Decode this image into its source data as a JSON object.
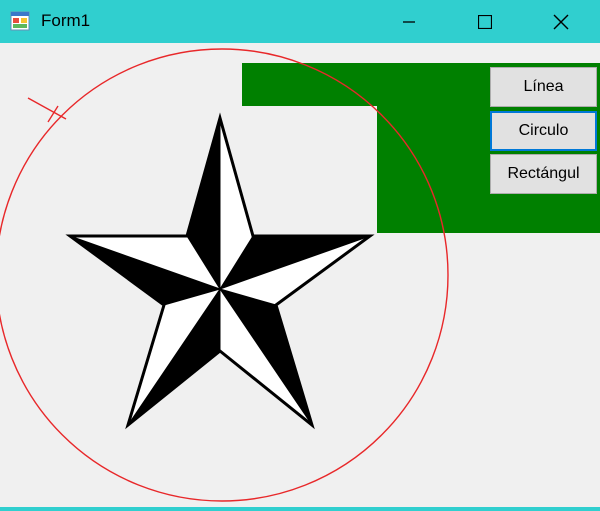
{
  "window": {
    "title": "Form1",
    "icons": {
      "app": "winforms-app-icon",
      "minimize": "minimize-icon",
      "maximize": "maximize-icon",
      "close": "close-icon"
    },
    "colors": {
      "titlebar": "#30cfcf",
      "client_background": "#f0f0f0"
    }
  },
  "buttons": {
    "linea": "Línea",
    "circulo": "Circulo",
    "rectangulo": "Rectángul",
    "focused": "circulo"
  },
  "canvas": {
    "shapes": [
      "line",
      "circle",
      "rectangle",
      "star"
    ],
    "colors": {
      "circle": "#e8282a",
      "line": "#e8282a",
      "rectangle": "#008000",
      "star_dark": "#000000",
      "star_light": "#ffffff"
    }
  }
}
